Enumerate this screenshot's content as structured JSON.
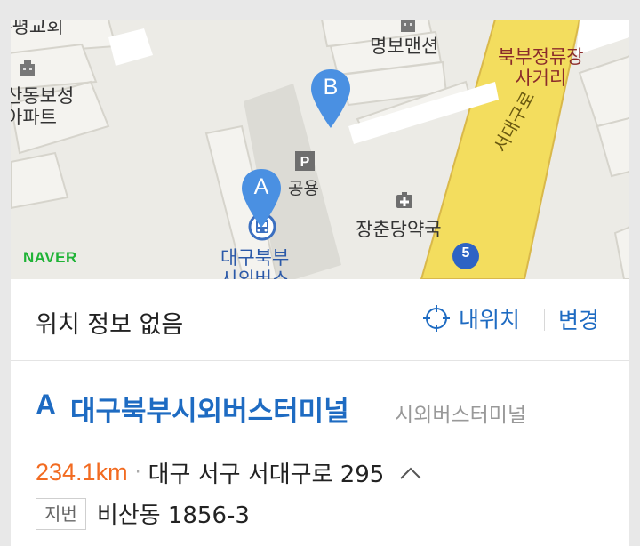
{
  "map": {
    "labels": {
      "church": "-평교회",
      "apartment": "산동보성\n아파트",
      "mansion": "명보맨션",
      "intersection": "북부정류장\n사거리",
      "parking": "공용",
      "pharmacy": "장춘당약국",
      "terminal": "대구북부\n시외버스",
      "road": "서대구로",
      "route_number": "5"
    },
    "markers": {
      "a": "A",
      "b": "B"
    },
    "brand": "NAVER",
    "colors": {
      "road": "#f3dd5e",
      "road_edge": "#d9b84a",
      "marker": "#4a90e2",
      "naver": "#1fb336"
    }
  },
  "location_bar": {
    "status": "위치 정보 없음",
    "my_location": "내위치",
    "change": "변경"
  },
  "result": {
    "marker": "A",
    "name": "대구북부시외버스터미널",
    "category": "시외버스터미널",
    "distance": "234.1km",
    "separator": "·",
    "address": "대구 서구 서대구로 295",
    "lot_tag": "지번",
    "lot_address": "비산동 1856-3",
    "colors": {
      "link": "#1e6bc2",
      "distance": "#f26b21"
    }
  }
}
